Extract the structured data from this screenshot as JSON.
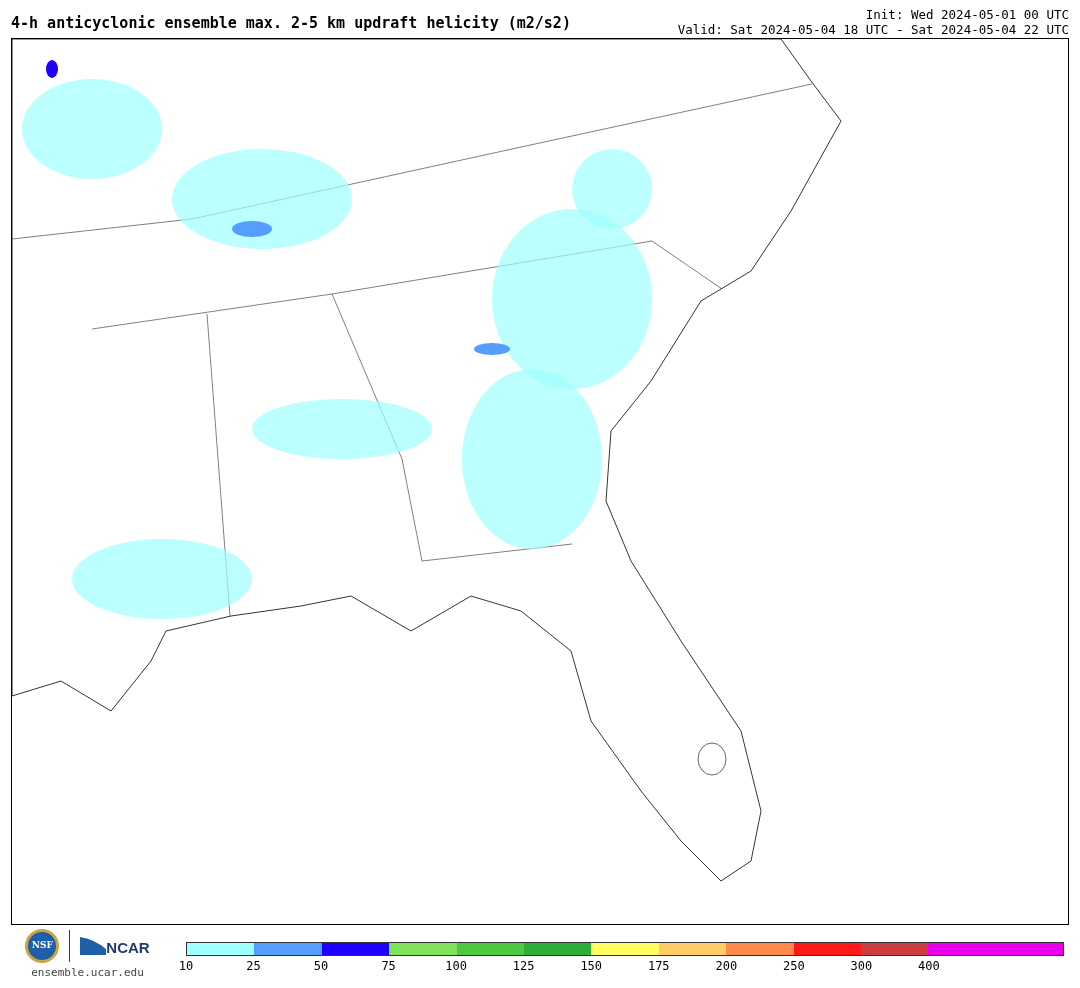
{
  "title": "4-h anticyclonic ensemble max. 2-5 km updraft helicity (m2/s2)",
  "init": "Init: Wed 2024-05-01 00 UTC",
  "valid": "Valid: Sat 2024-05-04 18 UTC - Sat 2024-05-04 22 UTC",
  "logos": {
    "nsf": "NSF",
    "ncar": "NCAR",
    "url": "ensemble.ucar.edu"
  },
  "colorbar": [
    {
      "color": "#a0ffff",
      "label": "10"
    },
    {
      "color": "#559dff",
      "label": "25"
    },
    {
      "color": "#1e00ff",
      "label": "50"
    },
    {
      "color": "#7fe25a",
      "label": "75"
    },
    {
      "color": "#4ec840",
      "label": "100"
    },
    {
      "color": "#2fae37",
      "label": "125"
    },
    {
      "color": "#fffd5f",
      "label": "150"
    },
    {
      "color": "#ffcc66",
      "label": "175"
    },
    {
      "color": "#ff884d",
      "label": "200"
    },
    {
      "color": "#ff1a1a",
      "label": "250"
    },
    {
      "color": "#cc3d3d",
      "label": "300"
    },
    {
      "color": "#ea00ea",
      "label": "400"
    }
  ]
}
